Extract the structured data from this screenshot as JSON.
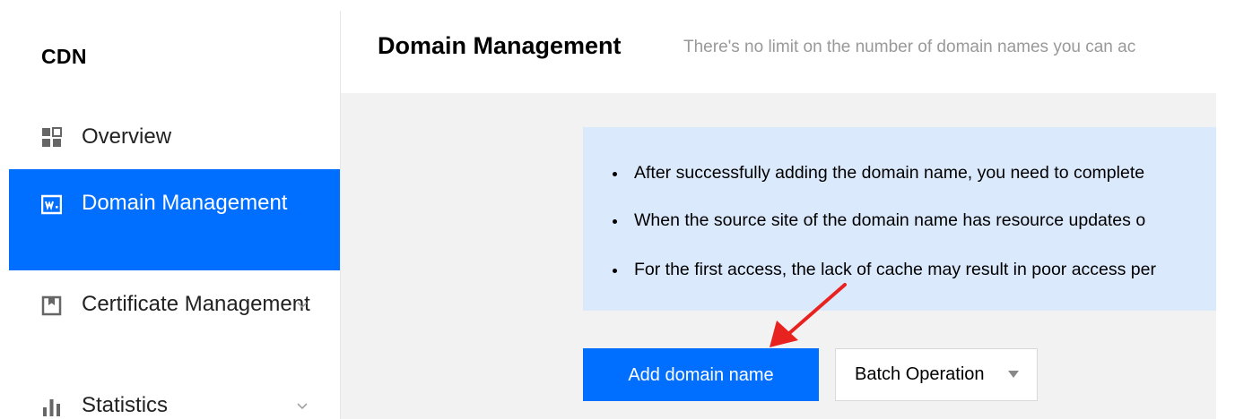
{
  "sidebar": {
    "app_name": "CDN",
    "items": [
      {
        "label": "Overview",
        "icon": "overview-grid-icon"
      },
      {
        "label": "Domain Management",
        "icon": "domain-www-icon"
      },
      {
        "label": "Certificate Management",
        "icon": "certificate-icon",
        "expandable": true
      },
      {
        "label": "Statistics",
        "icon": "statistics-bars-icon",
        "expandable": true
      }
    ],
    "active_index": 1
  },
  "header": {
    "title": "Domain Management",
    "subtitle": "There's no limit on the number of domain names you can ac"
  },
  "info": {
    "items": [
      "After successfully adding the domain name, you need to complete",
      "When the source site of the domain name has resource updates o",
      "For the first access, the lack of cache may result in poor access per"
    ]
  },
  "actions": {
    "add_label": "Add domain name",
    "batch_label": "Batch Operation"
  },
  "colors": {
    "accent": "#006eff",
    "info_background": "#dbe9fc",
    "annotation_arrow": "#e8231f"
  }
}
